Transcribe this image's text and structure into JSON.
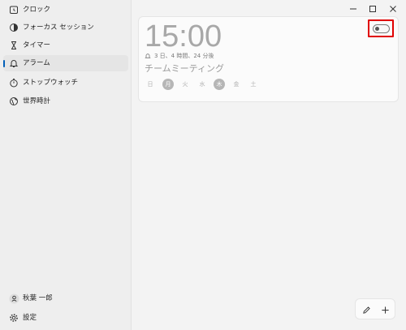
{
  "sidebar": {
    "items": [
      {
        "label": "クロック",
        "icon": "clock-icon"
      },
      {
        "label": "フォーカス セッション",
        "icon": "focus-session-icon"
      },
      {
        "label": "タイマー",
        "icon": "hourglass-icon"
      },
      {
        "label": "アラーム",
        "icon": "bell-icon",
        "active": true
      },
      {
        "label": "ストップウォッチ",
        "icon": "stopwatch-icon"
      },
      {
        "label": "世界時計",
        "icon": "globe-icon"
      }
    ],
    "user": {
      "label": "秋葉 一郎",
      "icon": "user-icon"
    },
    "settings": {
      "label": "設定",
      "icon": "gear-icon"
    }
  },
  "alarm": {
    "time": "15:00",
    "remaining": "3 日、4 時間、24 分後",
    "name": "チームミーティング",
    "enabled": false,
    "days": [
      {
        "label": "日",
        "selected": false
      },
      {
        "label": "月",
        "selected": true
      },
      {
        "label": "火",
        "selected": false
      },
      {
        "label": "水",
        "selected": false
      },
      {
        "label": "木",
        "selected": true
      },
      {
        "label": "金",
        "selected": false
      },
      {
        "label": "土",
        "selected": false
      }
    ]
  },
  "colors": {
    "accent": "#005fb8",
    "highlight_box": "#e00000",
    "selected_day": "#b6b6b6"
  }
}
